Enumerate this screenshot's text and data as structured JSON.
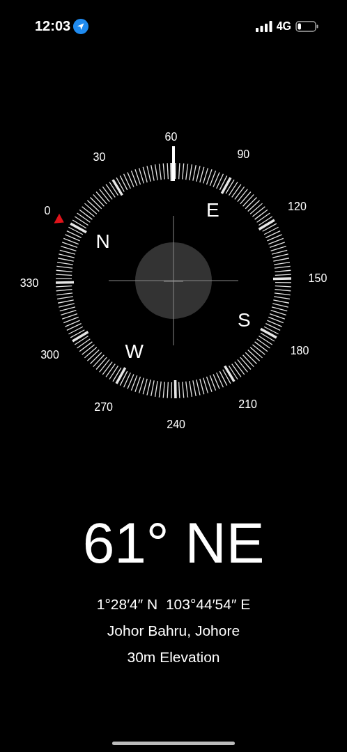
{
  "status_bar": {
    "time": "12:03",
    "network": "4G"
  },
  "dial": {
    "degree_labels": [
      "0",
      "30",
      "60",
      "90",
      "120",
      "150",
      "180",
      "210",
      "240",
      "270",
      "300",
      "330"
    ],
    "cardinal_labels": [
      "N",
      "E",
      "S",
      "W"
    ]
  },
  "heading": "61° NE",
  "coordinates": "1°28′4″ N  103°44′54″ E",
  "location": "Johor Bahru, Johore",
  "elevation": "30m Elevation"
}
